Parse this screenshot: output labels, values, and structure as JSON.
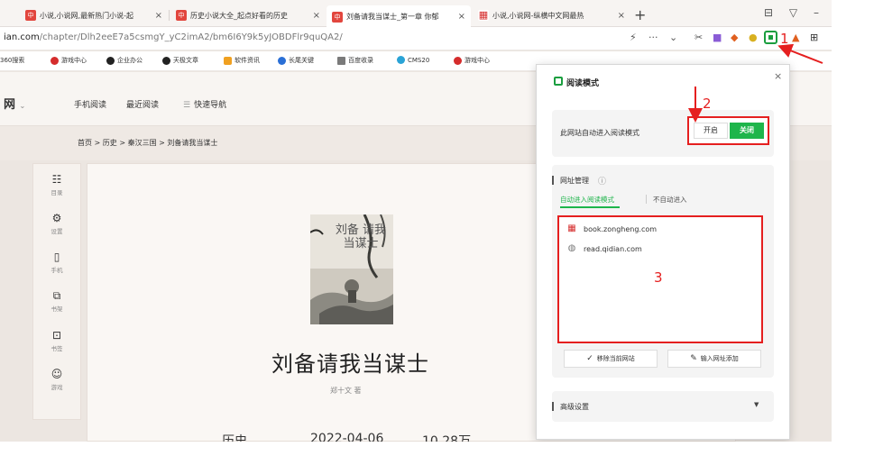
{
  "tabs": [
    {
      "favicon": "中",
      "title": "小说,小说网,最新热门小说-起",
      "active": false
    },
    {
      "favicon": "中",
      "title": "历史小说大全_起点好看的历史",
      "active": false
    },
    {
      "favicon": "中",
      "title": "刘备请我当谋士_第一章 你郁",
      "active": true
    },
    {
      "favicon": "grid-icon",
      "title": "小说,小说网-纵横中文网最热",
      "active": false
    }
  ],
  "tab_close": "×",
  "new_tab": "+",
  "address": {
    "host": "ian.com",
    "path": "/chapter/Dlh2eeE7a5csmgY_yC2imA2/bm6I6Y9k5yJOBDFlr9quQA2/"
  },
  "bookmarks": [
    {
      "label": "360搜索",
      "color": "#2a8ad6"
    },
    {
      "label": "游戏中心",
      "color": "#d52c2c"
    },
    {
      "label": "企业办公",
      "color": "#222222"
    },
    {
      "label": "天极文章",
      "color": "#222222"
    },
    {
      "label": "软件资讯",
      "color": "#f0a020"
    },
    {
      "label": "长尾关键",
      "color": "#2a6fd6"
    },
    {
      "label": "百度收录",
      "color": "#7a7a7a"
    },
    {
      "label": "CMS20",
      "color": "#2aa3d6"
    },
    {
      "label": "游戏中心",
      "color": "#d52c2c"
    }
  ],
  "site": {
    "logo": "网",
    "nav": [
      "手机阅读",
      "最近阅读",
      "快速导航"
    ]
  },
  "breadcrumb": "首页 > 历史 > 秦汉三国 > 刘备请我当谋士",
  "left_toolbar": [
    {
      "icon": "menu-icon",
      "glyph": "☷",
      "label": "目录"
    },
    {
      "icon": "gear-icon",
      "glyph": "⚙",
      "label": "设置"
    },
    {
      "icon": "phone-icon",
      "glyph": "▯",
      "label": "手机"
    },
    {
      "icon": "bookshelf-icon",
      "glyph": "⧉",
      "label": "书架"
    },
    {
      "icon": "bookmark-icon",
      "glyph": "⊡",
      "label": "书签"
    },
    {
      "icon": "gamepad-icon",
      "glyph": "☺",
      "label": "游戏"
    }
  ],
  "book": {
    "cover_text": "刘备 请我当谋士",
    "title": "刘备请我当谋士",
    "author": "郑十文 著",
    "meta": [
      "历史",
      "2022-04-06",
      "10.28万"
    ]
  },
  "popup": {
    "title": "阅读模式",
    "close": "×",
    "auto_label": "此网站自动进入阅读模式",
    "on_label": "开启",
    "off_label": "关闭",
    "manage_title": "网址管理",
    "help": "?",
    "subtab_auto": "自动进入阅读模式",
    "subtab_no": "不自动进入",
    "sites": [
      {
        "icon": "grid-icon",
        "domain": "book.zongheng.com"
      },
      {
        "icon": "globe-icon",
        "domain": "read.qidian.com"
      }
    ],
    "remove_btn": "移除当前网站",
    "add_btn": "输入网址添加",
    "advanced": "高级设置"
  },
  "annotations": [
    "1",
    "2",
    "3"
  ],
  "colors": {
    "accent_green": "#1eb54b",
    "highlight_red": "#e51f1f"
  }
}
